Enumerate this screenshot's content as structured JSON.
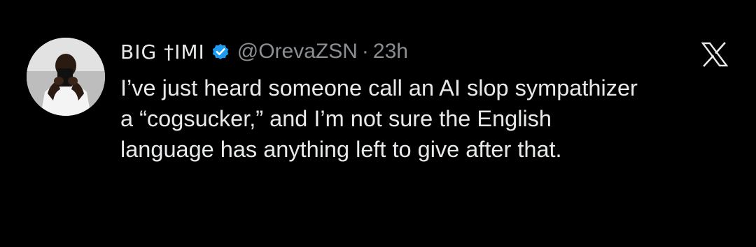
{
  "tweet": {
    "author": {
      "display_name": "BIG †IMI",
      "verified_icon": "verified-badge-icon",
      "handle": "@OrevaZSN",
      "separator": "·",
      "time": "23h",
      "avatar_icon": "profile-photo"
    },
    "platform_icon": "x-logo-icon",
    "text_lines": [
      "I’ve just heard someone call an AI slop sympathizer",
      "a “cogsucker,” and I’m not sure the English",
      "language has anything left to give after that."
    ]
  },
  "colors": {
    "background": "#000000",
    "primary_text": "#e7e9ea",
    "secondary_text": "#8b8f94",
    "verified_blue": "#1d9bf0"
  }
}
